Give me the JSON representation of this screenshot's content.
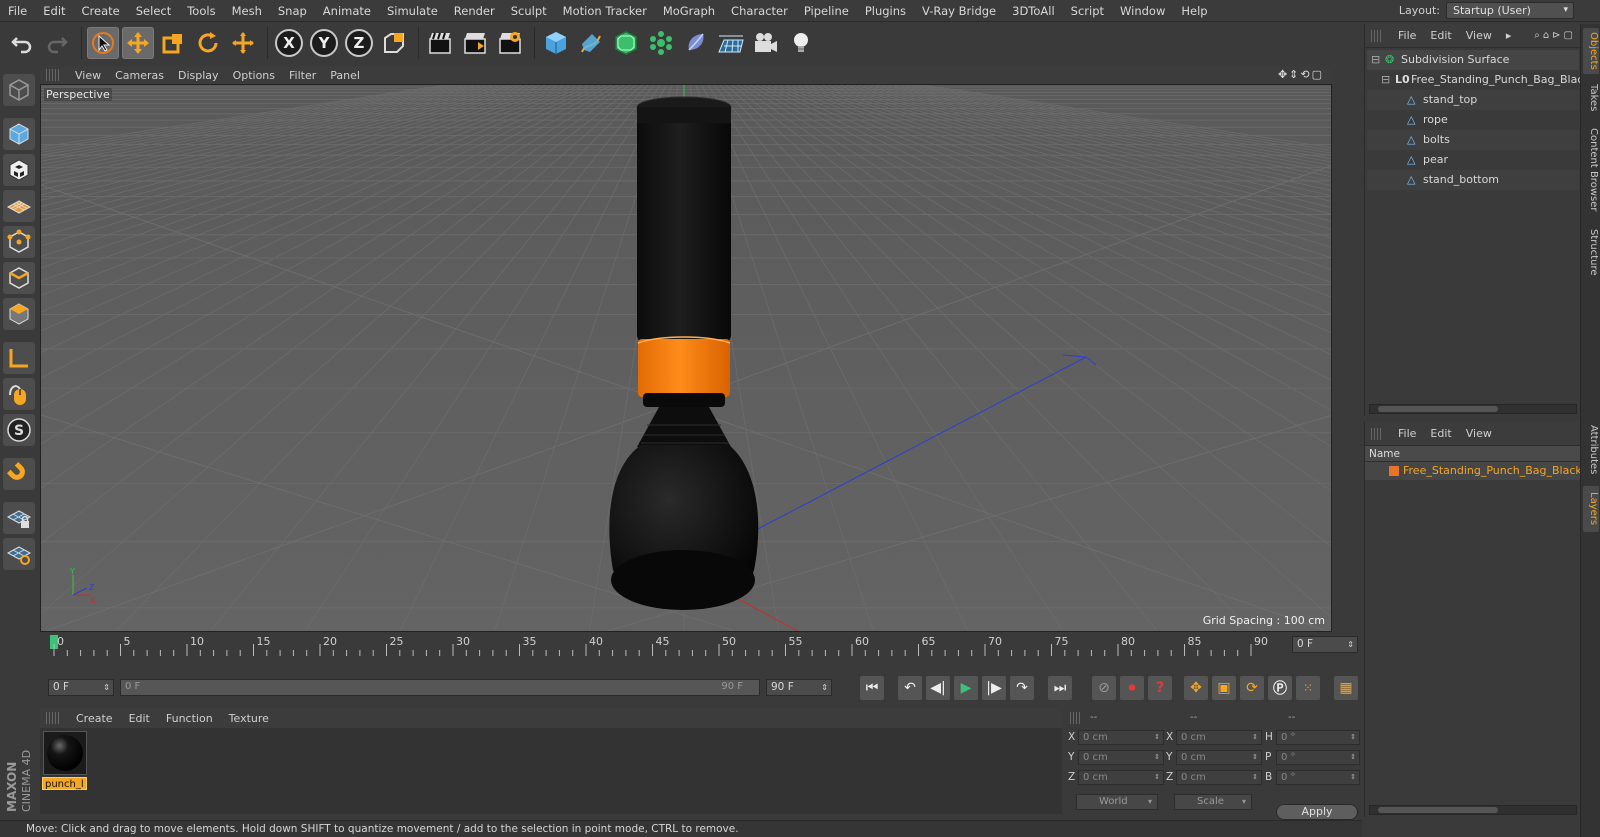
{
  "menu": [
    "File",
    "Edit",
    "Create",
    "Select",
    "Tools",
    "Mesh",
    "Snap",
    "Animate",
    "Simulate",
    "Render",
    "Sculpt",
    "Motion Tracker",
    "MoGraph",
    "Character",
    "Pipeline",
    "Plugins",
    "V-Ray Bridge",
    "3DToAll",
    "Script",
    "Window",
    "Help"
  ],
  "layout": {
    "label": "Layout:",
    "value": "Startup (User)"
  },
  "toolbar": {
    "axis_x": "X",
    "axis_y": "Y",
    "axis_z": "Z"
  },
  "viewport": {
    "menu": [
      "View",
      "Cameras",
      "Display",
      "Options",
      "Filter",
      "Panel"
    ],
    "camera_label": "Perspective",
    "grid_spacing": "Grid Spacing : 100 cm"
  },
  "timeline": {
    "ticks": [
      "0",
      "5",
      "10",
      "15",
      "20",
      "25",
      "30",
      "35",
      "40",
      "45",
      "50",
      "55",
      "60",
      "65",
      "70",
      "75",
      "80",
      "85",
      "90"
    ],
    "current_frame": "0 F",
    "start_frame": "0 F",
    "range_start": "0 F",
    "range_end": "90 F",
    "end_frame": "90 F"
  },
  "material_manager": {
    "menu": [
      "Create",
      "Edit",
      "Function",
      "Texture"
    ],
    "material_name": "punch_l"
  },
  "coordinates": {
    "headers": [
      "--",
      "--",
      "--"
    ],
    "rows": [
      {
        "pos_label": "X",
        "pos": "0 cm",
        "size_label": "X",
        "size": "0 cm",
        "rot_label": "H",
        "rot": "0 °"
      },
      {
        "pos_label": "Y",
        "pos": "0 cm",
        "size_label": "Y",
        "size": "0 cm",
        "rot_label": "P",
        "rot": "0 °"
      },
      {
        "pos_label": "Z",
        "pos": "0 cm",
        "size_label": "Z",
        "size": "0 cm",
        "rot_label": "B",
        "rot": "0 °"
      }
    ],
    "mode": "World",
    "size_mode": "Scale",
    "apply": "Apply"
  },
  "status": "Move: Click and drag to move elements. Hold down SHIFT to quantize movement / add to the selection in point mode, CTRL to remove.",
  "object_manager": {
    "menu": [
      "File",
      "Edit",
      "View"
    ],
    "objects": [
      {
        "name": "Subdivision Surface"
      },
      {
        "name": "Free_Standing_Punch_Bag_Black"
      },
      {
        "name": "stand_top"
      },
      {
        "name": "rope"
      },
      {
        "name": "bolts"
      },
      {
        "name": "pear"
      },
      {
        "name": "stand_bottom"
      }
    ]
  },
  "layer_manager": {
    "menu": [
      "File",
      "Edit",
      "View"
    ],
    "column": "Name",
    "layers": [
      "Free_Standing_Punch_Bag_Black"
    ]
  },
  "side_tabs": [
    "Objects",
    "Takes",
    "Content Browser",
    "Structure",
    "Attributes",
    "Layers"
  ],
  "branding": {
    "maxon": "MAXON",
    "product": "CINEMA 4D"
  },
  "colors": {
    "accent": "#f5a623",
    "background": "#3a3a3a",
    "bag_band": "#f57c10",
    "playhead": "#3fc07a"
  }
}
